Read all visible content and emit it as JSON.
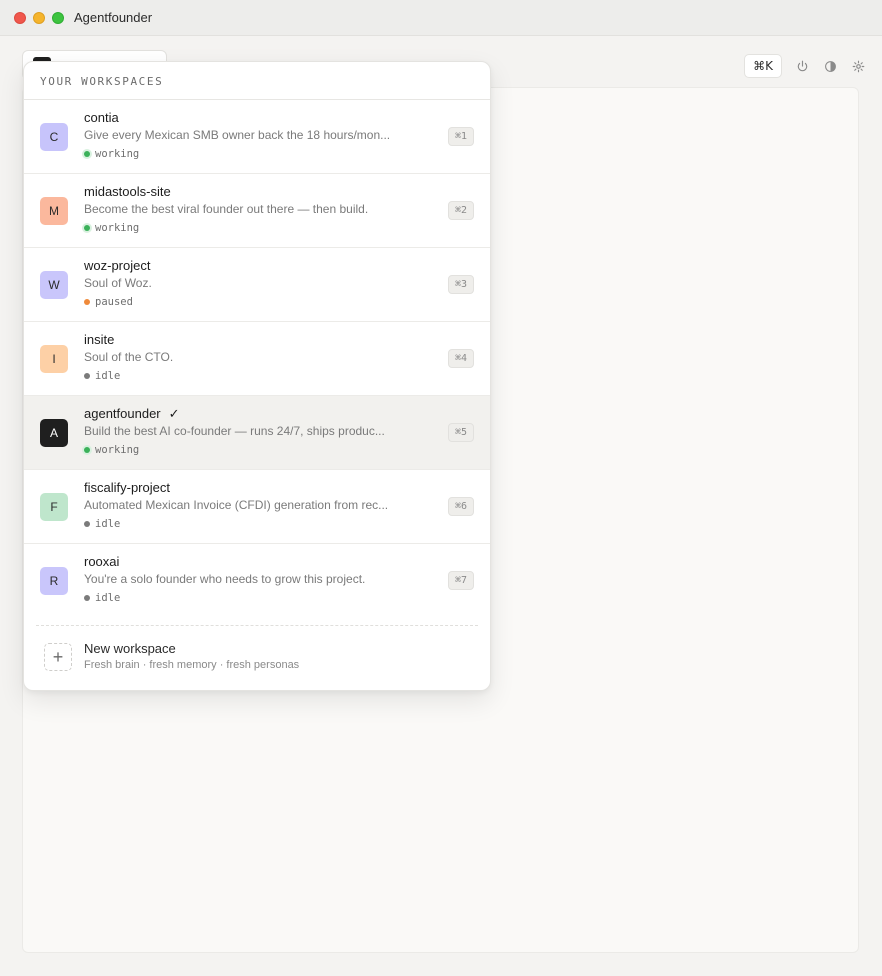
{
  "window": {
    "title": "Agentfounder"
  },
  "toolbar": {
    "command_shortcut": "⌘K",
    "power_icon": "power-icon",
    "theme_icon": "contrast-icon",
    "settings_icon": "gear-icon"
  },
  "dropdown": {
    "header": "YOUR WORKSPACES",
    "workspaces": [
      {
        "initial": "C",
        "avatar_color": "#c7c4fb",
        "name": "contia",
        "selected": false,
        "description": "Give every Mexican SMB owner back the 18 hours/mon...",
        "status": "working",
        "shortcut": "⌘1"
      },
      {
        "initial": "M",
        "avatar_color": "#fbb89d",
        "name": "midastools-site",
        "selected": false,
        "description": "Become the best viral founder out there — then build.",
        "status": "working",
        "shortcut": "⌘2"
      },
      {
        "initial": "W",
        "avatar_color": "#c9c6fb",
        "name": "woz-project",
        "selected": false,
        "description": "Soul of Woz.",
        "status": "paused",
        "shortcut": "⌘3"
      },
      {
        "initial": "I",
        "avatar_color": "#fdd0a6",
        "name": "insite",
        "selected": false,
        "description": "Soul of the CTO.",
        "status": "idle",
        "shortcut": "⌘4"
      },
      {
        "initial": "A",
        "avatar_color": "#1f1f1f",
        "name": "agentfounder",
        "selected": true,
        "check": "✓",
        "description": "Build the best AI co-founder — runs 24/7, ships produc...",
        "status": "working",
        "shortcut": "⌘5"
      },
      {
        "initial": "F",
        "avatar_color": "#bfe6cc",
        "name": "fiscalify-project",
        "selected": false,
        "description": "Automated Mexican Invoice (CFDI) generation from rec...",
        "status": "idle",
        "shortcut": "⌘6"
      },
      {
        "initial": "R",
        "avatar_color": "#c9c6fb",
        "name": "rooxai",
        "selected": false,
        "description": "You're a solo founder who needs to grow this project.",
        "status": "idle",
        "shortcut": "⌘7"
      }
    ],
    "new_workspace": {
      "icon": "+",
      "title": "New workspace",
      "subtitle": "Fresh brain · fresh memory · fresh personas"
    }
  }
}
